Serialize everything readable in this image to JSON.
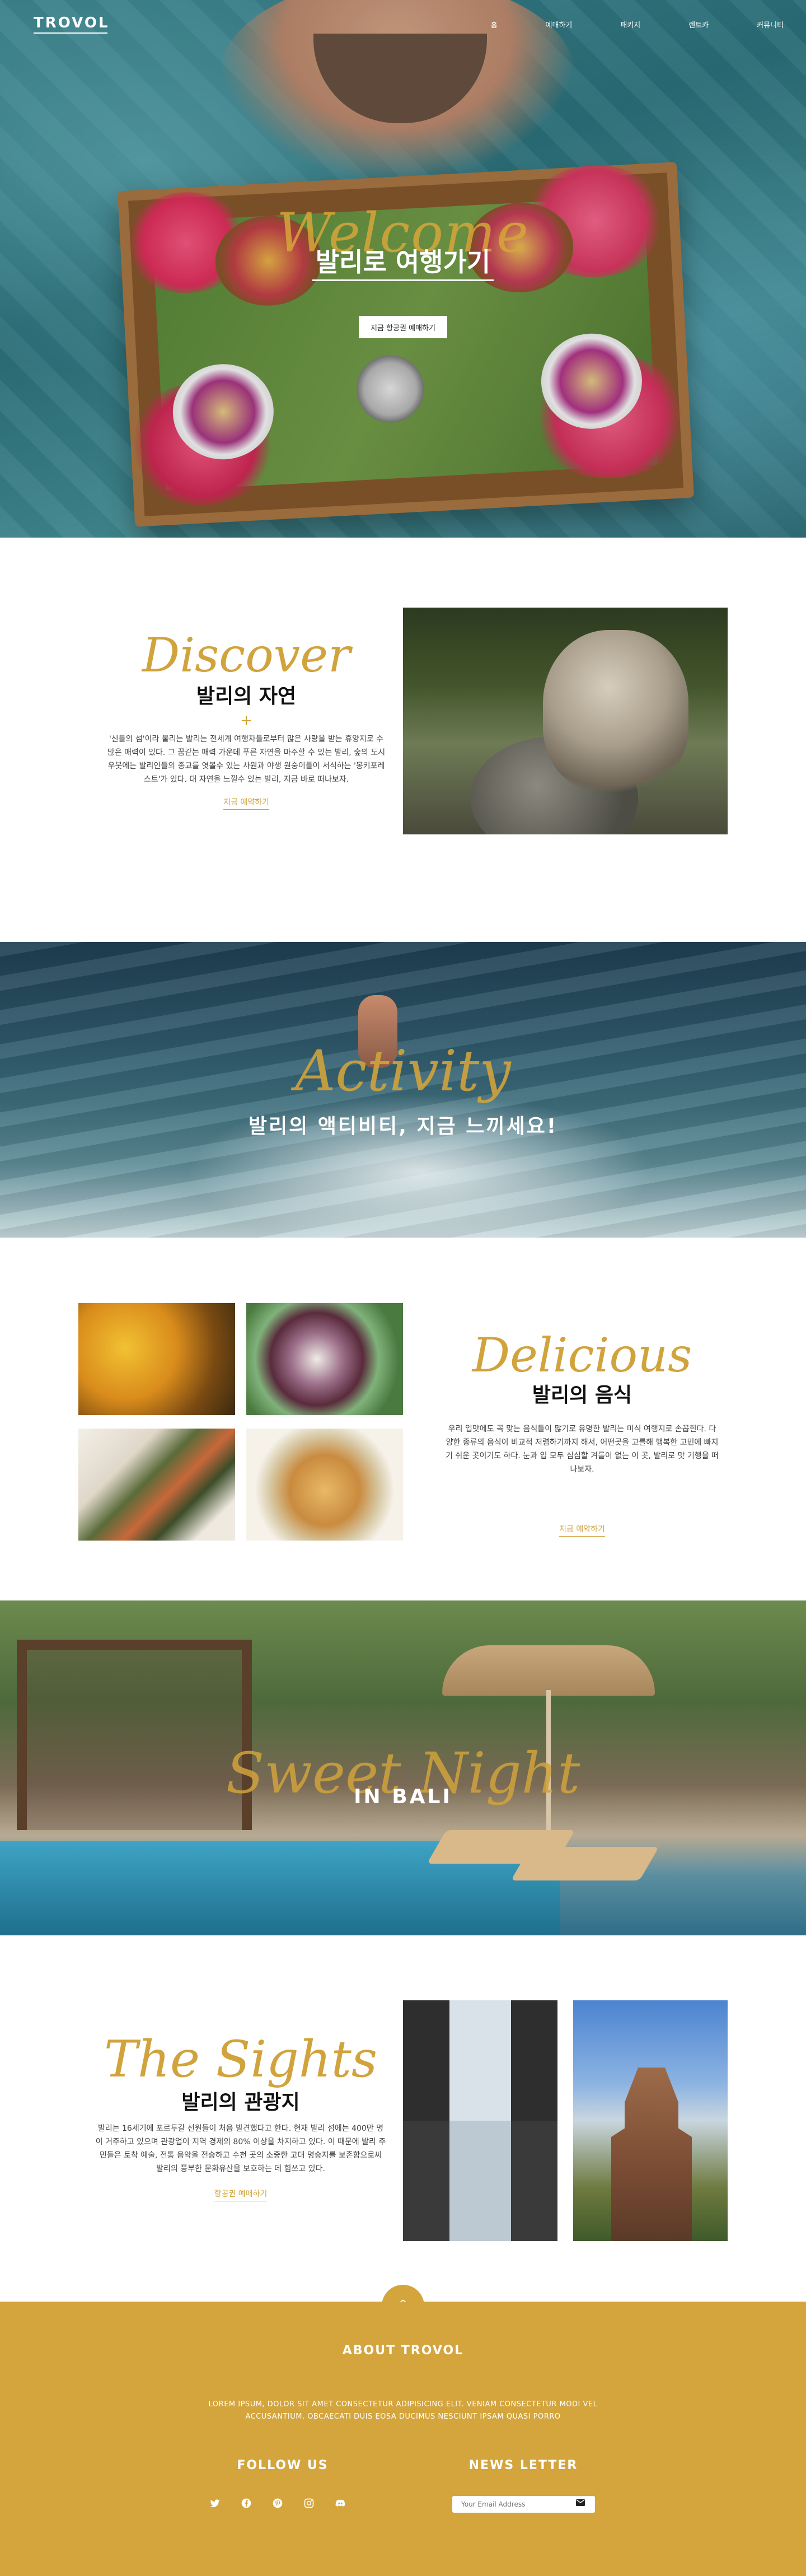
{
  "header": {
    "logo": "TROVOL",
    "nav": [
      "홈",
      "예매하기",
      "패키지",
      "렌트카",
      "커뮤니티"
    ]
  },
  "hero": {
    "script": "Welcome",
    "title": "발리로 여행가기",
    "subtitle": "",
    "button": "지금 항공권 예매하기"
  },
  "discover": {
    "script": "Discover",
    "title": "발리의 자연",
    "plus": "+",
    "text": "'신들의 섬'이라 불리는 발리는 전세계 여행자들로부터 많은 사랑을 받는 휴양지로 수많은 매력이 있다. 그 꿈같는 매력 가운데 푸른 자연을 마주할 수 있는 발리, 숲의 도시 우붓에는 발리인들의 종교를 엿볼수 있는 사원과 야생 원숭이들이 서식하는 '몽키포레스트'가 있다. 대 자연을 느낄수 있는 발리, 지금 바로 떠나보자.",
    "link": "지금 예약하기"
  },
  "activity": {
    "script": "Activity",
    "title": "발리의 액티비티, 지금 느끼세요!"
  },
  "delicious": {
    "script": "Delicious",
    "title": "발리의 음식",
    "text": "우리 입맛에도 꼭 맞는 음식들이 많기로 유명한 발리는 미식 여행지로 손꼽힌다. 다양한 종류의 음식이 비교적 저렴하기까지 해서, 어떤곳을 고를해 행복한 고민에 빠지기 쉬운 곳이기도 하다. 눈과 입 모두 심심할 겨를이 없는 이 곳, 발리로 맛 기행을 떠나보자.",
    "link": "지금 예약하기"
  },
  "night": {
    "script": "Sweet Night",
    "title": "IN BALI"
  },
  "sights": {
    "script": "The Sights",
    "title": "발리의 관광지",
    "text": "발리는 16세기에 포르투갈 선원들이 처음 발견했다고 한다. 현재 발리 섬에는 400만 명이 거주하고 있으며 관광업이 지역 경제의 80% 이상을 차지하고 있다. 이 때문에 발리 주민들은 토착 예술, 전통 음악을 전승하고 수천 곳의 소중한 고대 명승지를 보존함으로써 발리의 풍부한 문화유산을 보호하는 데 힘쓰고 있다.",
    "link": "항공권 예매하기"
  },
  "footer": {
    "up_icon": "chevron-up",
    "about_title": "ABOUT TROVOL",
    "about_text": "LOREM IPSUM, DOLOR SIT AMET CONSECTETUR ADIPISICING ELIT. VENIAM CONSECTETUR MODI VEL ACCUSANTIUM, OBCAECATI DUIS EOSA DUCIMUS NESCIUNT IPSAM QUASI PORRO",
    "follow_title": "FOLLOW US",
    "social": [
      "twitter-icon",
      "facebook-icon",
      "pinterest-icon",
      "instagram-icon",
      "discord-icon"
    ],
    "news_title": "NEWS LETTER",
    "email_placeholder": "Your Email Address"
  },
  "colors": {
    "accent": "#d4a43d",
    "script_gold": "#d1a33c"
  }
}
